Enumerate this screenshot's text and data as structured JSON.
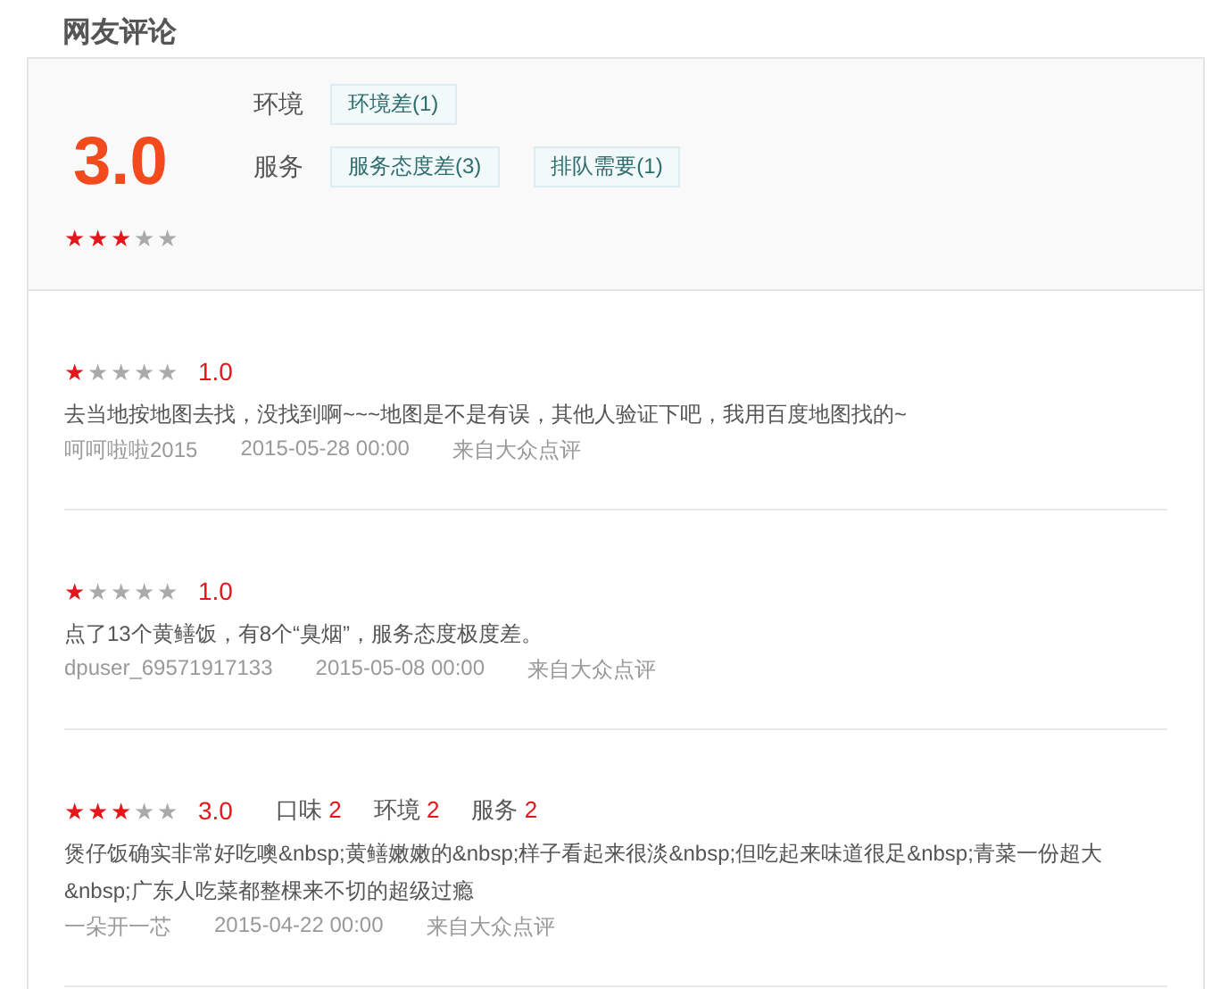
{
  "title": "网友评论",
  "summary": {
    "score": "3.0",
    "stars": 3,
    "categories": [
      {
        "label": "环境",
        "tags": [
          "环境差(1)"
        ]
      },
      {
        "label": "服务",
        "tags": [
          "服务态度差(3)",
          "排队需要(1)"
        ]
      }
    ]
  },
  "reviews": [
    {
      "stars": 1,
      "score": "1.0",
      "text": "去当地按地图去找，没找到啊~~~地图是不是有误，其他人验证下吧，我用百度地图找的~",
      "user": "呵呵啦啦2015",
      "date": "2015-05-28 00:00",
      "source": "来自大众点评"
    },
    {
      "stars": 1,
      "score": "1.0",
      "text": "点了13个黄鳝饭，有8个“臭烟”，服务态度极度差。",
      "user": "dpuser_69571917133",
      "date": "2015-05-08 00:00",
      "source": "来自大众点评"
    },
    {
      "stars": 3,
      "score": "3.0",
      "ratings": [
        {
          "label": "口味",
          "value": "2"
        },
        {
          "label": "环境",
          "value": "2"
        },
        {
          "label": "服务",
          "value": "2"
        }
      ],
      "text": "煲仔饭确实非常好吃噢&nbsp;黄鳝嫩嫩的&nbsp;样子看起来很淡&nbsp;但吃起来味道很足&nbsp;青菜一份超大&nbsp;广东人吃菜都整棵来不切的超级过瘾",
      "user": "一朵开一芯",
      "date": "2015-04-22 00:00",
      "source": "来自大众点评"
    }
  ]
}
